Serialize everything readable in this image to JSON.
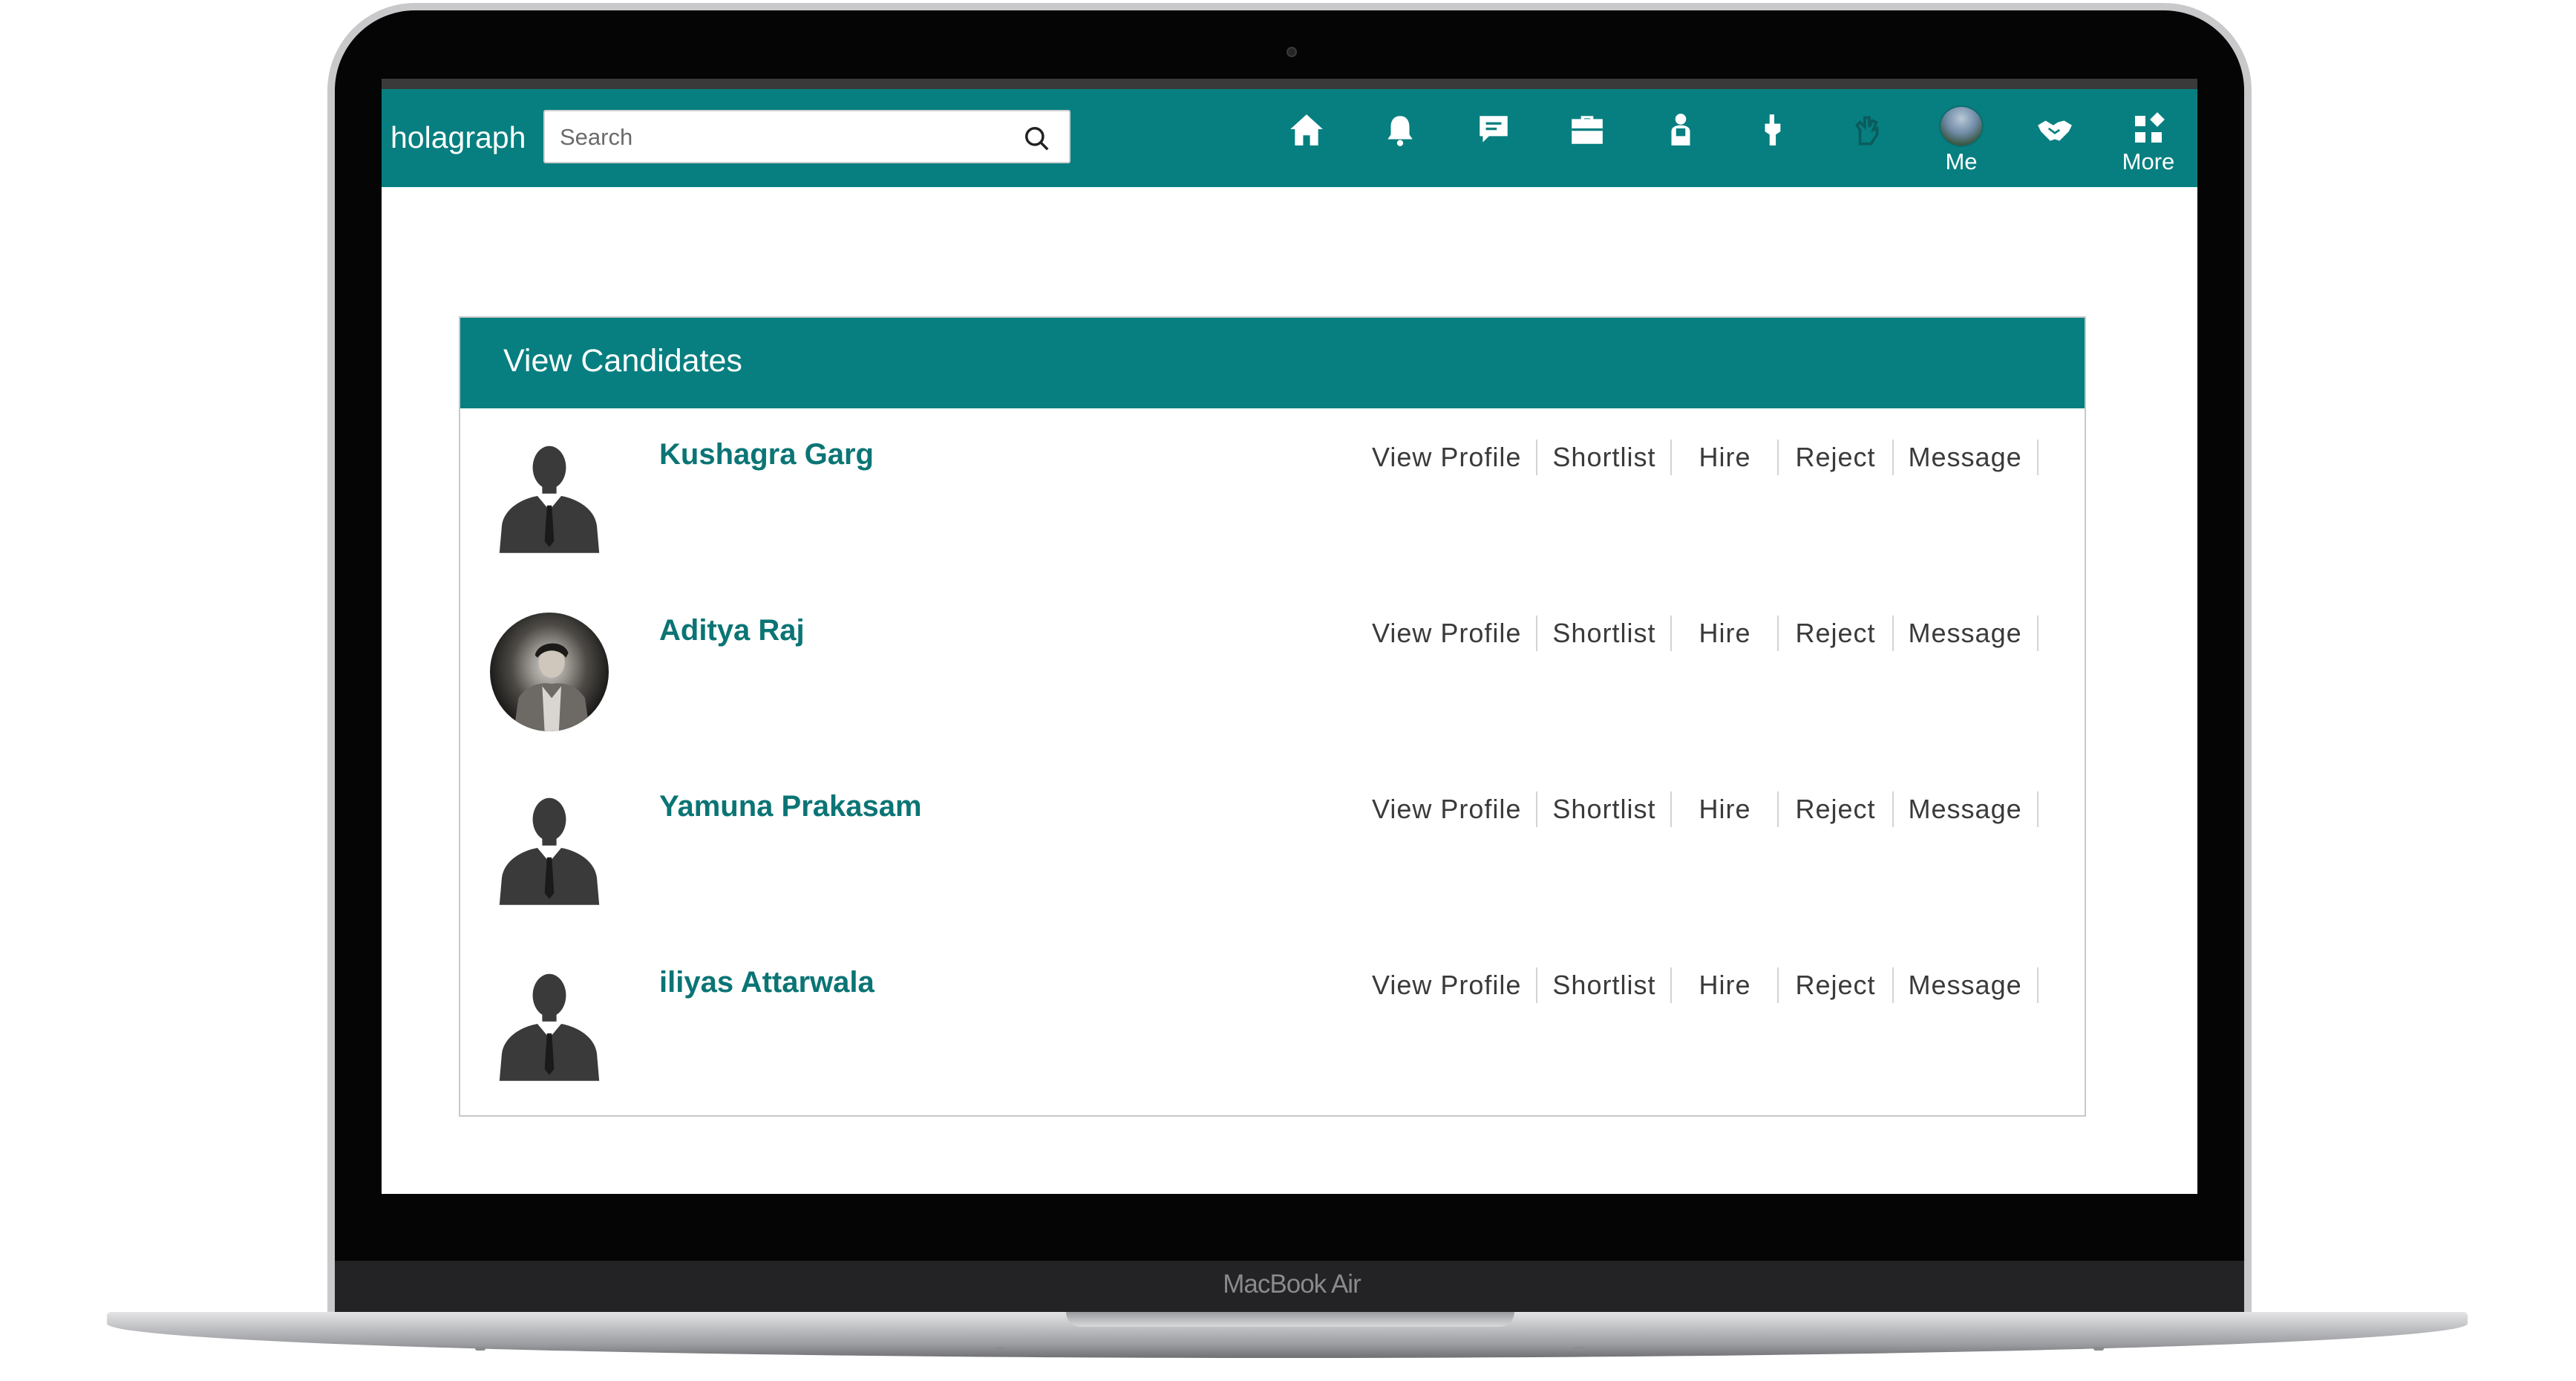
{
  "device": {
    "label": "MacBook Air"
  },
  "header": {
    "logo": "holagraph",
    "search": {
      "placeholder": "Search",
      "value": ""
    },
    "nav": [
      {
        "icon": "home-icon",
        "label": ""
      },
      {
        "icon": "bell-icon",
        "label": ""
      },
      {
        "icon": "chat-icon",
        "label": ""
      },
      {
        "icon": "briefcase-icon",
        "label": ""
      },
      {
        "icon": "mentor-icon",
        "label": ""
      },
      {
        "icon": "thumbs-icon",
        "label": ""
      },
      {
        "icon": "hand-icon",
        "label": ""
      },
      {
        "icon": "avatar",
        "label": "Me"
      },
      {
        "icon": "handshake-icon",
        "label": ""
      },
      {
        "icon": "grid-icon",
        "label": "More"
      }
    ]
  },
  "main": {
    "title": "View Candidates",
    "action_labels": [
      "View Profile",
      "Shortlist",
      "Hire",
      "Reject",
      "Message"
    ],
    "candidates": [
      {
        "name": "Kushagra Garg",
        "photo": "silhouette"
      },
      {
        "name": "Aditya Raj",
        "photo": "photo"
      },
      {
        "name": "Yamuna Prakasam",
        "photo": "silhouette"
      },
      {
        "name": "iliyas Attarwala",
        "photo": "silhouette"
      }
    ]
  },
  "colors": {
    "brand": "#077f80",
    "name": "#0b7475",
    "action_text": "#3a3a3a"
  }
}
